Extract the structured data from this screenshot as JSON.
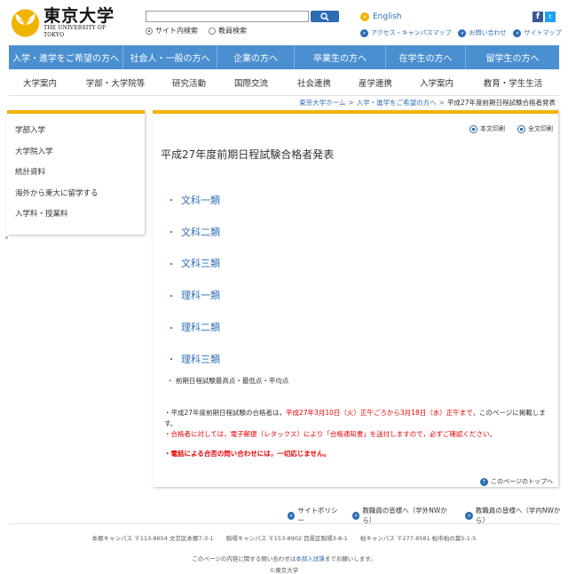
{
  "header": {
    "logo_jp": "東京大学",
    "logo_en": "THE UNIVERSITY OF TOKYO",
    "search": {
      "value": "",
      "placeholder": "",
      "radio_site": "サイト内検索",
      "radio_staff": "教員検索"
    },
    "lang_label": "English",
    "facebook": "f",
    "twitter": "t",
    "util_links": [
      "アクセス・キャンパスマップ",
      "お問い合わせ",
      "サイトマップ"
    ]
  },
  "blue_nav": [
    "入学・進学をご希望の方へ",
    "社会人・一般の方へ",
    "企業の方へ",
    "卒業生の方へ",
    "在学生の方へ",
    "留学生の方へ"
  ],
  "sub_nav": [
    "大学案内",
    "学部・大学院等",
    "研究活動",
    "国際交流",
    "社会連携",
    "産学連携",
    "入学案内",
    "教育・学生生活"
  ],
  "breadcrumb": {
    "home": "東京大学ホーム",
    "parent": "入学・進学をご希望の方へ",
    "current": "平成27年度前期日程試験合格者発表"
  },
  "sidebar": [
    "学部入学",
    "大学院入学",
    "統計資料",
    "海外から東大に留学する",
    "入学料・授業料"
  ],
  "main": {
    "print_body": "本文印刷",
    "print_all": "全文印刷",
    "title": "平成27年度前期日程試験合格者発表",
    "categories": [
      "文科一類",
      "文科二類",
      "文科三類",
      "理科一類",
      "理科二類",
      "理科三類"
    ],
    "stats_link": "・ 前期日程試験最高点・最低点・平均点",
    "notice1_a": "・平成27年度前期日程試験の合格者は，",
    "notice1_red": "平成27年3月10日（火）正午ごろから3月18日（水）正午まで",
    "notice1_b": "，このページに掲載します。",
    "notice2": "・合格者に対しては，電子郵便（レタックス）により「合格通知書」を送付しますので，必ずご確認ください。",
    "notice3": "・電話による合否の問い合わせには，一切応じません。",
    "to_top": "このページのトップへ"
  },
  "footer": {
    "links": [
      "サイトポリシー",
      "教職員の皆様へ（学外NWから）",
      "教職員の皆様へ（学内NWから）"
    ],
    "address": [
      "本郷キャンパス 〒113-8654 文京区本郷7-3-1",
      "駒場キャンパス 〒153-8902 目黒区駒場3-8-1",
      "柏キャンパス 〒277-8581 柏市柏の葉5-1-5"
    ],
    "contact_a": "このページの内容に関する問い合わせは",
    "contact_link": "本部入試課",
    "contact_b": "までお願いします。",
    "copyright": "©東京大学"
  },
  "colors": {
    "nav_blue": "#4a8fd0",
    "link_blue": "#2d6db5",
    "accent_yellow": "#f0b400",
    "alert_red": "#e60000"
  }
}
